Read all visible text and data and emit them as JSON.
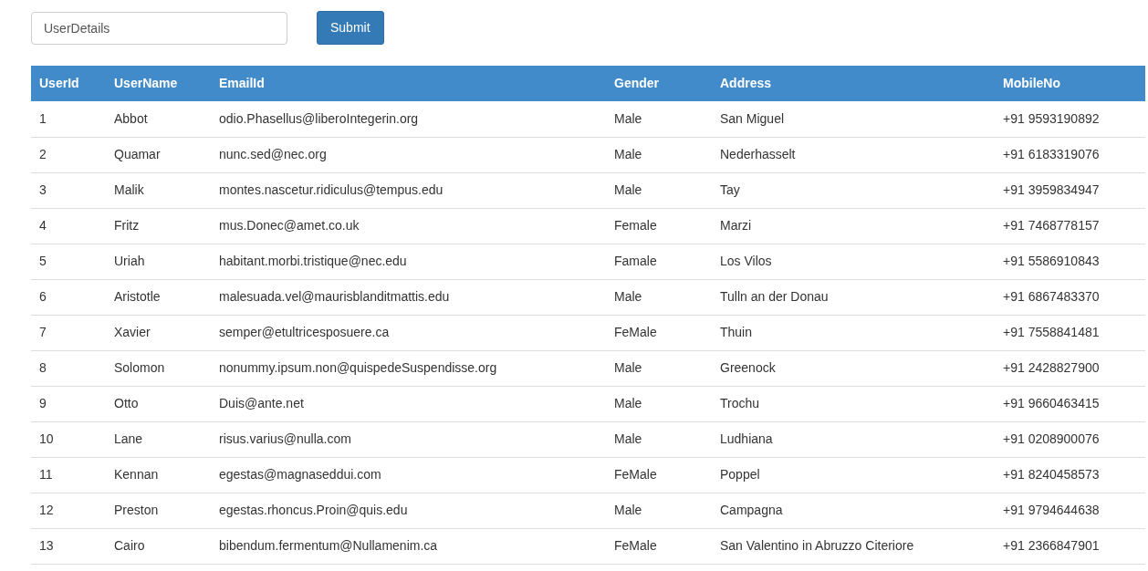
{
  "search": {
    "value": "UserDetails"
  },
  "submit_button": "Submit",
  "table": {
    "columns": [
      "UserId",
      "UserName",
      "EmailId",
      "Gender",
      "Address",
      "MobileNo"
    ],
    "rows": [
      [
        "1",
        "Abbot",
        "odio.Phasellus@liberoIntegerin.org",
        "Male",
        "San Miguel",
        "+91 9593190892"
      ],
      [
        "2",
        "Quamar",
        "nunc.sed@nec.org",
        "Male",
        "Nederhasselt",
        "+91 6183319076"
      ],
      [
        "3",
        "Malik",
        "montes.nascetur.ridiculus@tempus.edu",
        "Male",
        "Tay",
        "+91 3959834947"
      ],
      [
        "4",
        "Fritz",
        "mus.Donec@amet.co.uk",
        "Female",
        "Marzi",
        "+91 7468778157"
      ],
      [
        "5",
        "Uriah",
        "habitant.morbi.tristique@nec.edu",
        "Famale",
        "Los Vilos",
        "+91 5586910843"
      ],
      [
        "6",
        "Aristotle",
        "malesuada.vel@maurisblanditmattis.edu",
        "Male",
        "Tulln an der Donau",
        "+91 6867483370"
      ],
      [
        "7",
        "Xavier",
        "semper@etultricesposuere.ca",
        "FeMale",
        "Thuin",
        "+91 7558841481"
      ],
      [
        "8",
        "Solomon",
        "nonummy.ipsum.non@quispedeSuspendisse.org",
        "Male",
        "Greenock",
        "+91 2428827900"
      ],
      [
        "9",
        "Otto",
        "Duis@ante.net",
        "Male",
        "Trochu",
        "+91 9660463415"
      ],
      [
        "10",
        "Lane",
        "risus.varius@nulla.com",
        "Male",
        "Ludhiana",
        "+91 0208900076"
      ],
      [
        "11",
        "Kennan",
        "egestas@magnaseddui.com",
        "FeMale",
        "Poppel",
        "+91 8240458573"
      ],
      [
        "12",
        "Preston",
        "egestas.rhoncus.Proin@quis.edu",
        "Male",
        "Campagna",
        "+91 9794644638"
      ],
      [
        "13",
        "Cairo",
        "bibendum.fermentum@Nullamenim.ca",
        "FeMale",
        "San Valentino in Abruzzo Citeriore",
        "+91 2366847901"
      ]
    ]
  }
}
